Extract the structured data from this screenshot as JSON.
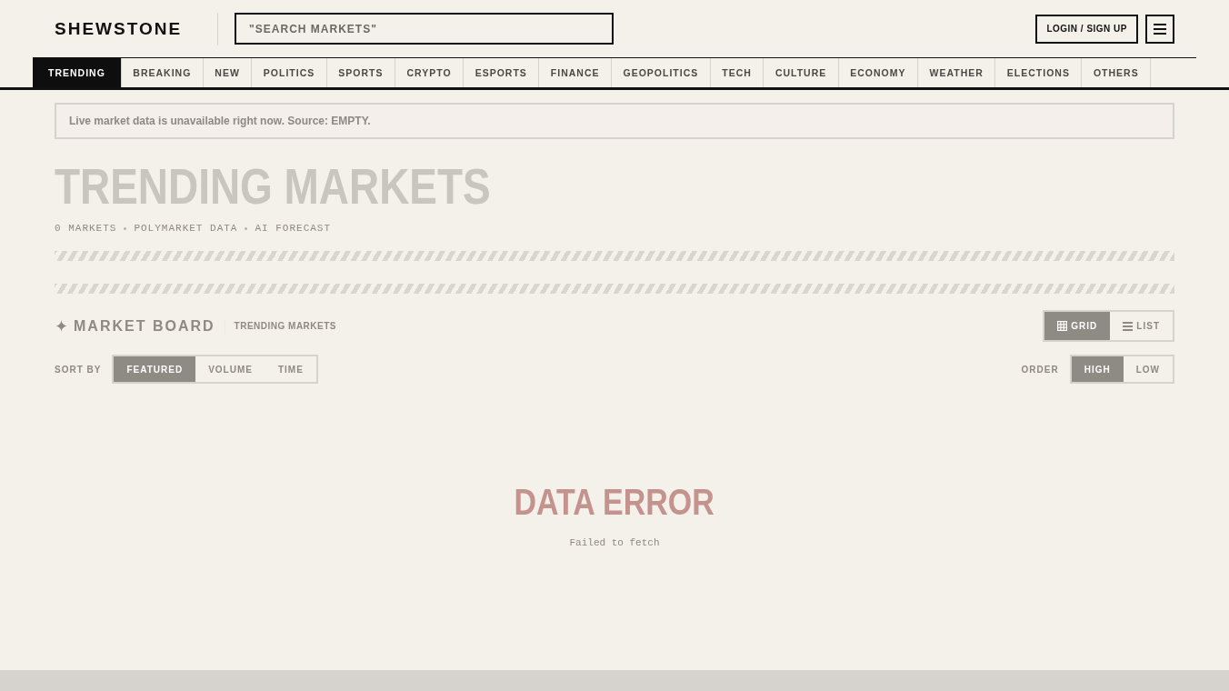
{
  "header": {
    "logo": "SHEWSTONE",
    "search": {
      "placeholder": "\"SEARCH MARKETS\""
    },
    "login_button": "LOGIN / SIGN UP"
  },
  "tabs": [
    {
      "label": "TRENDING",
      "selected": true
    },
    {
      "label": "BREAKING",
      "selected": false
    },
    {
      "label": "NEW",
      "selected": false
    },
    {
      "label": "POLITICS",
      "selected": false
    },
    {
      "label": "SPORTS",
      "selected": false
    },
    {
      "label": "CRYPTO",
      "selected": false
    },
    {
      "label": "ESPORTS",
      "selected": false
    },
    {
      "label": "FINANCE",
      "selected": false
    },
    {
      "label": "GEOPOLITICS",
      "selected": false
    },
    {
      "label": "TECH",
      "selected": false
    },
    {
      "label": "CULTURE",
      "selected": false
    },
    {
      "label": "ECONOMY",
      "selected": false
    },
    {
      "label": "WEATHER",
      "selected": false
    },
    {
      "label": "ELECTIONS",
      "selected": false
    },
    {
      "label": "OTHERS",
      "selected": false
    }
  ],
  "alert": "Live market data is unavailable right now. Source: EMPTY.",
  "page_title": "TRENDING MARKETS",
  "meta": [
    "0 MARKETS",
    "POLYMARKET DATA",
    "AI FORECAST"
  ],
  "board": {
    "icon": "✦",
    "title": "MARKET BOARD",
    "subtitle": "TRENDING MARKETS",
    "views": [
      {
        "kind": "grid",
        "label": "GRID",
        "selected": true
      },
      {
        "kind": "list",
        "label": "LIST",
        "selected": false
      }
    ],
    "sort_label": "SORT BY",
    "sort": [
      {
        "label": "FEATURED",
        "selected": true
      },
      {
        "label": "VOLUME",
        "selected": false
      },
      {
        "label": "TIME",
        "selected": false
      }
    ],
    "order_label": "ORDER",
    "order": [
      {
        "label": "HIGH",
        "selected": true
      },
      {
        "label": "LOW",
        "selected": false
      }
    ]
  },
  "error": {
    "title": "DATA ERROR",
    "message": "Failed to fetch"
  }
}
